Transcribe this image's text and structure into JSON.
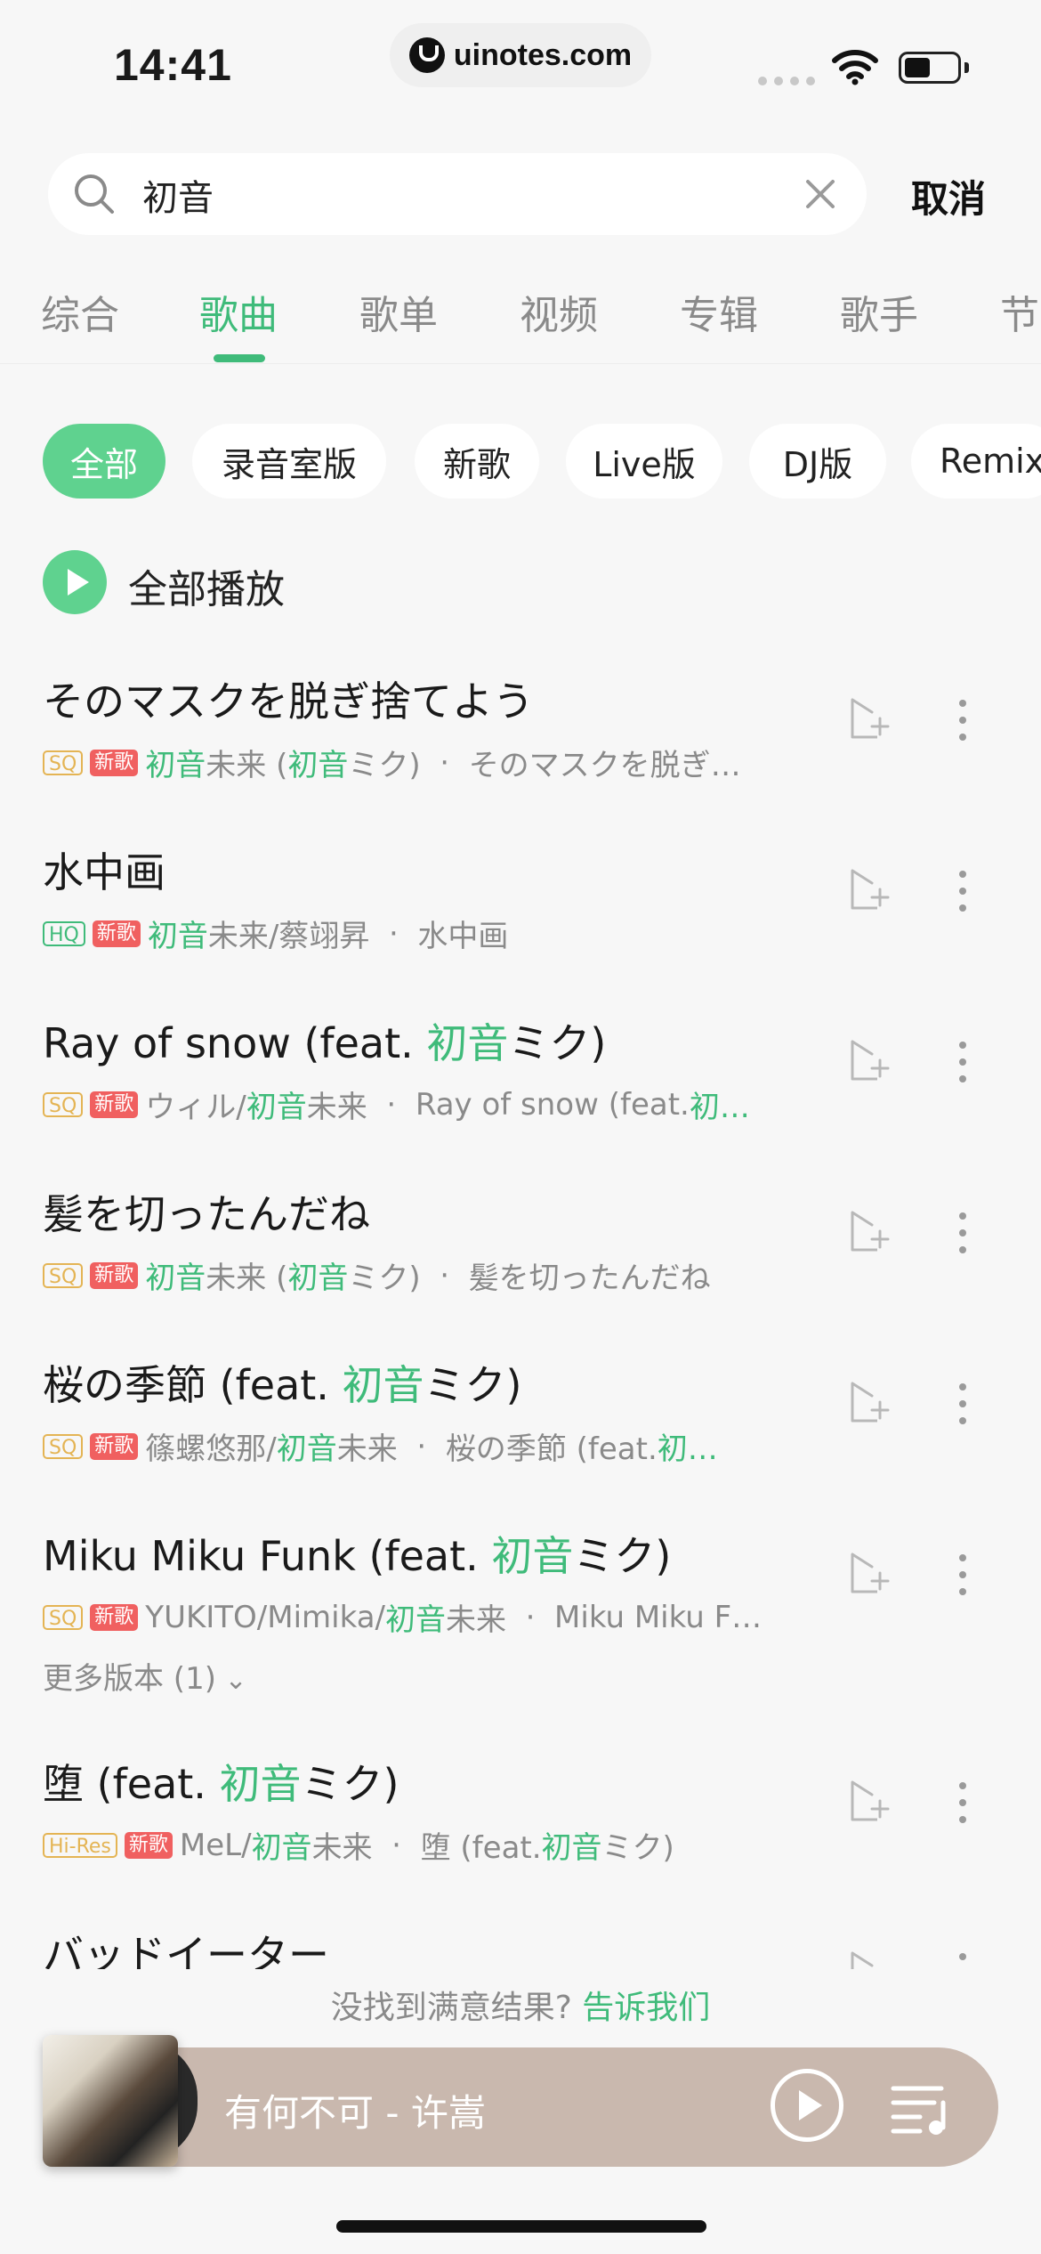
{
  "status_bar": {
    "time": "14:41",
    "url": "uinotes.com"
  },
  "search": {
    "query": "初音",
    "cancel": "取消"
  },
  "tabs": [
    {
      "label": "综合"
    },
    {
      "label": "歌曲"
    },
    {
      "label": "歌单"
    },
    {
      "label": "视频"
    },
    {
      "label": "专辑"
    },
    {
      "label": "歌手"
    },
    {
      "label": "节"
    }
  ],
  "active_tab": "歌曲",
  "filters": [
    {
      "label": "全部"
    },
    {
      "label": "录音室版"
    },
    {
      "label": "新歌"
    },
    {
      "label": "Live版"
    },
    {
      "label": "DJ版"
    },
    {
      "label": "Remix"
    }
  ],
  "play_all": "全部播放",
  "songs": [
    {
      "title": [
        "そのマスクを脱ぎ捨てよう"
      ],
      "quality": "SQ",
      "new": "新歌",
      "artist": [
        "",
        "初音",
        "未来 (",
        "初音",
        "ミク)"
      ],
      "album": [
        "そのマスクを脱ぎ…"
      ]
    },
    {
      "title": [
        "水中画"
      ],
      "quality": "HQ",
      "new": "新歌",
      "artist": [
        "",
        "初音",
        "未来/蔡翊昇"
      ],
      "album": [
        "水中画"
      ]
    },
    {
      "title": [
        "Ray of snow (feat. ",
        "初音",
        "ミク)"
      ],
      "quality": "SQ",
      "new": "新歌",
      "artist": [
        "ウィル/",
        "初音",
        "未来"
      ],
      "album": [
        "Ray of snow (feat. ",
        "初…"
      ]
    },
    {
      "title": [
        "髪を切ったんだね"
      ],
      "quality": "SQ",
      "new": "新歌",
      "artist": [
        "",
        "初音",
        "未来 (",
        "初音",
        "ミク)"
      ],
      "album": [
        "髪を切ったんだね"
      ]
    },
    {
      "title": [
        "桜の季節 (feat. ",
        "初音",
        "ミク)"
      ],
      "quality": "SQ",
      "new": "新歌",
      "artist": [
        "篠螺悠那/",
        "初音",
        "未来"
      ],
      "album": [
        "桜の季節 (feat. ",
        "初…"
      ]
    },
    {
      "title": [
        "Miku Miku Funk (feat. ",
        "初音",
        "ミク)"
      ],
      "quality": "SQ",
      "new": "新歌",
      "artist": [
        "YUKITO/Mimika/",
        "初音",
        "未来"
      ],
      "album": [
        "Miku Miku F…"
      ],
      "more_versions": "更多版本 (1)"
    },
    {
      "title": [
        "堕 (feat. ",
        "初音",
        "ミク)"
      ],
      "quality": "Hi-Res",
      "new": "新歌",
      "artist": [
        "MeL/",
        "初音",
        "未来"
      ],
      "album": [
        "堕 (feat. ",
        "初音",
        "ミク)"
      ]
    },
    {
      "title": [
        "バッドイーター"
      ]
    }
  ],
  "feedback": {
    "text": "没找到满意结果? ",
    "link": "告诉我们"
  },
  "player": {
    "now_playing": "有何不可 - 许嵩"
  },
  "colors": {
    "accent": "#3fbb7a",
    "chip_active": "#5fd28f",
    "new_badge": "#f06060",
    "sq_badge": "#e4b454"
  },
  "icons": [
    "search-icon",
    "clear-icon",
    "play-icon",
    "add-to-playlist-icon",
    "more-vertical-icon",
    "chevron-down-icon",
    "playlist-icon",
    "wifi-icon",
    "battery-icon"
  ]
}
